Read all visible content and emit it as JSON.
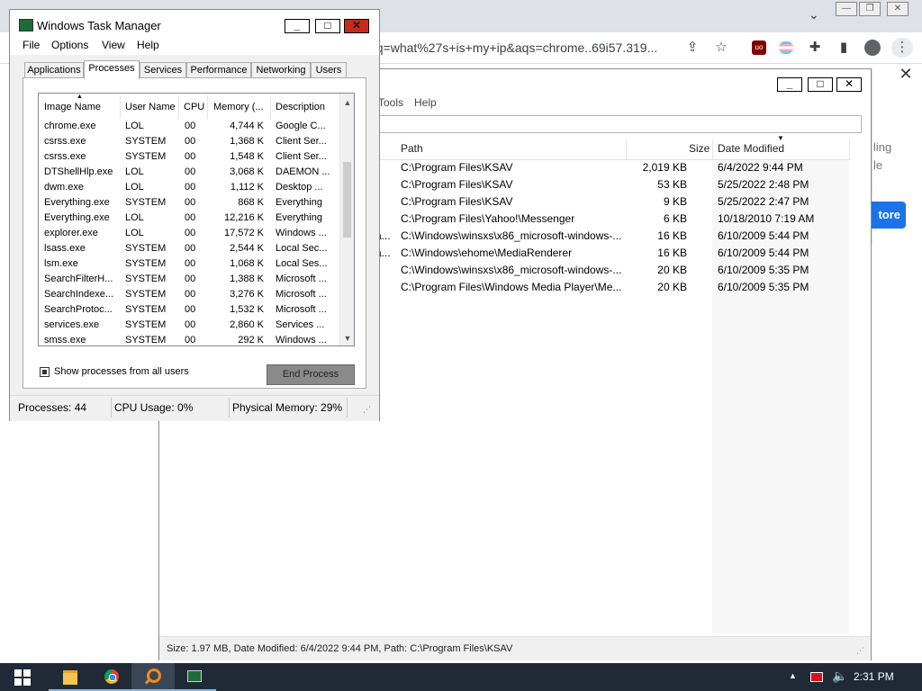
{
  "chrome": {
    "url": "oq=what%27s+is+my+ip&aqs=chrome..69i57.319...",
    "window_buttons": [
      "—",
      "❐",
      "✕"
    ],
    "side_text_1": "ling",
    "side_text_2": "le",
    "side_button": "tore",
    "side_close": "✕"
  },
  "everything": {
    "menus": [
      "Tools",
      "Help"
    ],
    "columns": {
      "path": "Path",
      "size": "Size",
      "date_modified": "Date Modified"
    },
    "rows": [
      {
        "prefix": "",
        "path": "C:\\Program Files\\KSAV",
        "size": "2,019 KB",
        "date": "6/4/2022 9:44 PM"
      },
      {
        "prefix": "",
        "path": "C:\\Program Files\\KSAV",
        "size": "53 KB",
        "date": "5/25/2022 2:48 PM"
      },
      {
        "prefix": "",
        "path": "C:\\Program Files\\KSAV",
        "size": "9 KB",
        "date": "5/25/2022 2:47 PM"
      },
      {
        "prefix": "",
        "path": "C:\\Program Files\\Yahoo!\\Messenger",
        "size": "6 KB",
        "date": "10/18/2010 7:19 AM"
      },
      {
        "prefix": "a...",
        "path": "C:\\Windows\\winsxs\\x86_microsoft-windows-...",
        "size": "16 KB",
        "date": "6/10/2009 5:44 PM"
      },
      {
        "prefix": "a...",
        "path": "C:\\Windows\\ehome\\MediaRenderer",
        "size": "16 KB",
        "date": "6/10/2009 5:44 PM"
      },
      {
        "prefix": "",
        "path": "C:\\Windows\\winsxs\\x86_microsoft-windows-...",
        "size": "20 KB",
        "date": "6/10/2009 5:35 PM"
      },
      {
        "prefix": "",
        "path": "C:\\Program Files\\Windows Media Player\\Me...",
        "size": "20 KB",
        "date": "6/10/2009 5:35 PM"
      }
    ],
    "status": "Size: 1.97 MB, Date Modified: 6/4/2022 9:44 PM, Path: C:\\Program Files\\KSAV"
  },
  "taskmanager": {
    "title": "Windows Task Manager",
    "menus": [
      "File",
      "Options",
      "View",
      "Help"
    ],
    "tabs": [
      "Applications",
      "Processes",
      "Services",
      "Performance",
      "Networking",
      "Users"
    ],
    "active_tab": "Processes",
    "columns": [
      "Image Name",
      "User Name",
      "CPU",
      "Memory (...",
      "Description"
    ],
    "processes": [
      [
        "chrome.exe",
        "LOL",
        "00",
        "4,744 K",
        "Google C..."
      ],
      [
        "csrss.exe",
        "SYSTEM",
        "00",
        "1,368 K",
        "Client Ser..."
      ],
      [
        "csrss.exe",
        "SYSTEM",
        "00",
        "1,548 K",
        "Client Ser..."
      ],
      [
        "DTShellHlp.exe",
        "LOL",
        "00",
        "3,068 K",
        "DAEMON ..."
      ],
      [
        "dwm.exe",
        "LOL",
        "00",
        "1,112 K",
        "Desktop ..."
      ],
      [
        "Everything.exe",
        "SYSTEM",
        "00",
        "868 K",
        "Everything"
      ],
      [
        "Everything.exe",
        "LOL",
        "00",
        "12,216 K",
        "Everything"
      ],
      [
        "explorer.exe",
        "LOL",
        "00",
        "17,572 K",
        "Windows ..."
      ],
      [
        "lsass.exe",
        "SYSTEM",
        "00",
        "2,544 K",
        "Local Sec..."
      ],
      [
        "lsm.exe",
        "SYSTEM",
        "00",
        "1,068 K",
        "Local Ses..."
      ],
      [
        "SearchFilterH...",
        "SYSTEM",
        "00",
        "1,388 K",
        "Microsoft ..."
      ],
      [
        "SearchIndexe...",
        "SYSTEM",
        "00",
        "3,276 K",
        "Microsoft ..."
      ],
      [
        "SearchProtoc...",
        "SYSTEM",
        "00",
        "1,532 K",
        "Microsoft ..."
      ],
      [
        "services.exe",
        "SYSTEM",
        "00",
        "2,860 K",
        "Services ..."
      ],
      [
        "smss.exe",
        "SYSTEM",
        "00",
        "292 K",
        "Windows ..."
      ]
    ],
    "show_all_label": "Show processes from all users",
    "end_process_label": "End Process",
    "status": {
      "processes": "Processes: 44",
      "cpu": "CPU Usage: 0%",
      "memory": "Physical Memory: 29%"
    }
  },
  "taskbar": {
    "clock": "2:31 PM",
    "apps": [
      "explorer-icon",
      "chrome-icon",
      "everything-icon",
      "taskmanager-icon"
    ]
  }
}
